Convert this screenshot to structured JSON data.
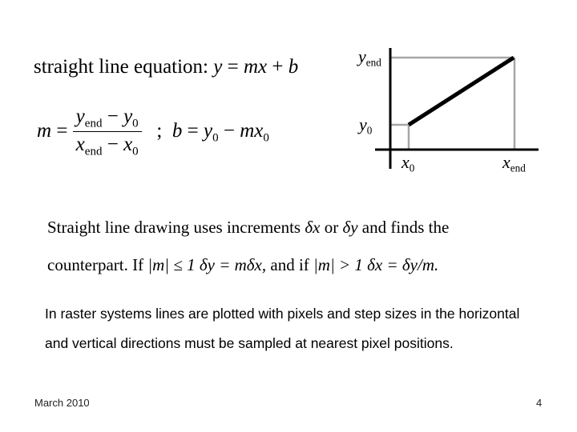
{
  "slide": {
    "equation_heading": {
      "label": "straight line equation:",
      "formula": {
        "lhs": "y",
        "eq": "=",
        "m": "m",
        "x": "x",
        "plus": "+",
        "b": "b"
      }
    },
    "slope_formula": {
      "m": "m",
      "eq": "=",
      "num": {
        "y": "y",
        "end_sub": "end",
        "minus": "−",
        "y0": "y",
        "sub0": "0"
      },
      "den": {
        "x": "x",
        "end_sub": "end",
        "minus": "−",
        "x0": "x",
        "sub0": "0"
      },
      "separator": ";",
      "b_expr": {
        "b": "b",
        "eq": "=",
        "y": "y",
        "sub0": "0",
        "minus": "−",
        "m": "m",
        "x": "x",
        "xsub0": "0"
      }
    },
    "diagram": {
      "labels": {
        "y_end": {
          "var": "y",
          "sub": "end"
        },
        "y_0": {
          "var": "y",
          "sub": "0"
        },
        "x_0": {
          "var": "x",
          "sub": "0"
        },
        "x_end": {
          "var": "x",
          "sub": "end"
        }
      },
      "colors": {
        "axis": "#000000",
        "guide": "#a6a6a6",
        "line": "#000000"
      }
    },
    "increments": {
      "line1": {
        "text1": "Straight line drawing uses increments",
        "dx": "δx",
        "or": "or",
        "dy": "δy",
        "text2": "and finds the"
      },
      "line2": {
        "text1": "counterpart. If",
        "cond1": "|m| ≤ 1",
        "eq1": "δy = mδx,",
        "text2": "and if",
        "cond2": "|m| > 1",
        "eq2": "δx = δy/m."
      }
    },
    "body": "In raster systems lines are plotted with pixels and step sizes in the horizontal and vertical directions must be sampled at nearest pixel positions.",
    "footer": {
      "date": "March 2010",
      "page": "4"
    }
  }
}
